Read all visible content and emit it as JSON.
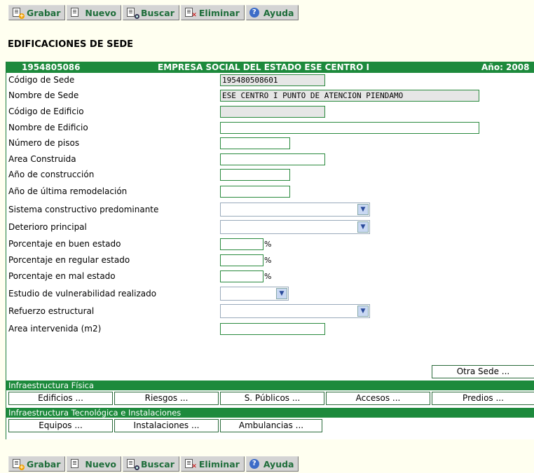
{
  "toolbar": {
    "save": "Grabar",
    "new": "Nuevo",
    "search": "Buscar",
    "delete": "Eliminar",
    "help": "Ayuda"
  },
  "page_title": "EDIFICACIONES DE SEDE",
  "header": {
    "code": "1954805086",
    "entity": "EMPRESA SOCIAL DEL ESTADO ESE CENTRO I",
    "year": "Año: 2008"
  },
  "form": {
    "site_code_label": "Código de Sede",
    "site_code_value": "195480508601",
    "site_name_label": "Nombre de Sede",
    "site_name_value": "ESE CENTRO I PUNTO DE ATENCION PIENDAMO",
    "building_code_label": "Código de Edificio",
    "building_name_label": "Nombre de Edificio",
    "floors_label": "Número de pisos",
    "built_area_label": "Area Construida",
    "construction_year_label": "Año de construcción",
    "remodel_year_label": "Año de última remodelación",
    "construction_system_label": "Sistema constructivo predominante",
    "main_deterioration_label": "Deterioro principal",
    "good_state_label": "Porcentaje en buen estado",
    "regular_state_label": "Porcentaje en regular estado",
    "bad_state_label": "Porcentaje en mal estado",
    "vulnerability_label": "Estudio de vulnerabilidad realizado",
    "reinforcement_label": "Refuerzo estructural",
    "intervened_area_label": "Area intervenida (m2)",
    "percent_symbol": "%"
  },
  "other_site_button": "Otra Sede ...",
  "physical": {
    "title": "Infraestructura Física",
    "buttons": [
      "Edificios ...",
      "Riesgos ...",
      "S. Públicos ...",
      "Accesos ...",
      "Predios ..."
    ]
  },
  "tech": {
    "title": "Infraestructura Tecnológica e Instalaciones",
    "buttons": [
      "Equipos ...",
      "Instalaciones ...",
      "Ambulancias ..."
    ]
  },
  "colors": {
    "header_green": "#1d8a3c",
    "toolbar_text": "#1f6e3b",
    "page_background": "#fffff0"
  }
}
